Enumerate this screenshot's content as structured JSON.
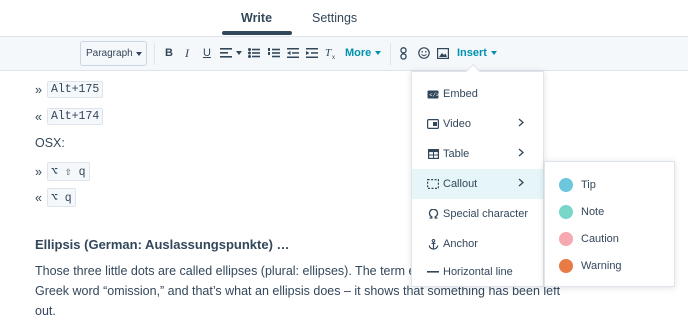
{
  "tabs": {
    "write": "Write",
    "settings": "Settings"
  },
  "toolbar": {
    "paragraph": "Paragraph",
    "bold": "B",
    "italic": "I",
    "underline": "U",
    "more": "More",
    "insert": "Insert"
  },
  "content": {
    "lines": [
      {
        "prefix": "»",
        "key": "Alt+175"
      },
      {
        "prefix": "«",
        "key": "Alt+174"
      },
      {
        "text": "OSX:"
      },
      {
        "prefix": "»",
        "key": "⌥ ⇧ q"
      },
      {
        "prefix": "«",
        "key": "⌥ q"
      }
    ],
    "heading": "Ellipsis (German: Auslassungspunkte) …",
    "paragraph_lines": [
      "Those three little dots are called ellipses (plural: ellipses). The term ell",
      "Greek word “omission,” and that’s what an ellipsis does – it shows that something has been left",
      "out."
    ]
  },
  "insert_menu": {
    "items": [
      {
        "label": "Embed",
        "icon": "embed-icon",
        "submenu": false
      },
      {
        "label": "Video",
        "icon": "video-icon",
        "submenu": true
      },
      {
        "label": "Table",
        "icon": "table-icon",
        "submenu": true
      },
      {
        "label": "Callout",
        "icon": "callout-icon",
        "submenu": true,
        "active": true
      },
      {
        "label": "Special character",
        "icon": "omega-icon",
        "submenu": false
      },
      {
        "label": "Anchor",
        "icon": "anchor-icon",
        "submenu": false
      },
      {
        "label": "Horizontal line",
        "icon": "horizontal-line-icon",
        "submenu": false
      }
    ]
  },
  "callout_menu": {
    "items": [
      {
        "label": "Tip",
        "color": "#6cc7dc"
      },
      {
        "label": "Note",
        "color": "#7ad6c9"
      },
      {
        "label": "Caution",
        "color": "#f5a9b0"
      },
      {
        "label": "Warning",
        "color": "#e87a45"
      }
    ]
  },
  "colors": {
    "accent": "#0091ae",
    "text": "#33475b",
    "active_bg": "#e5f5f8"
  }
}
